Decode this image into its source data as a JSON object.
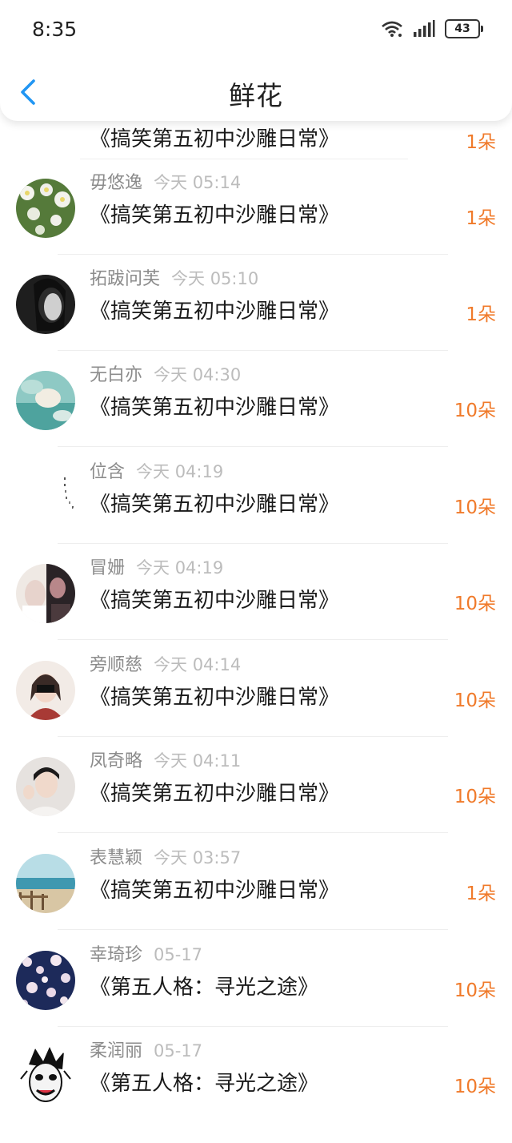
{
  "status_bar": {
    "time": "8:35",
    "battery": "43"
  },
  "header": {
    "title": "鲜花"
  },
  "colors": {
    "accent_blue": "#2196f3",
    "count_orange": "#f07a2a"
  },
  "items": [
    {
      "name": "",
      "time": "",
      "book": "《搞笑第五初中沙雕日常》",
      "count": "1朵"
    },
    {
      "name": "毋悠逸",
      "time": "今天 05:14",
      "book": "《搞笑第五初中沙雕日常》",
      "count": "1朵"
    },
    {
      "name": "拓跋问芙",
      "time": "今天 05:10",
      "book": "《搞笑第五初中沙雕日常》",
      "count": "1朵"
    },
    {
      "name": "无白亦",
      "time": "今天 04:30",
      "book": "《搞笑第五初中沙雕日常》",
      "count": "10朵"
    },
    {
      "name": "位含",
      "time": "今天 04:19",
      "book": "《搞笑第五初中沙雕日常》",
      "count": "10朵"
    },
    {
      "name": "冒姗",
      "time": "今天 04:19",
      "book": "《搞笑第五初中沙雕日常》",
      "count": "10朵"
    },
    {
      "name": "旁顺慈",
      "time": "今天 04:14",
      "book": "《搞笑第五初中沙雕日常》",
      "count": "10朵"
    },
    {
      "name": "凤奇略",
      "time": "今天 04:11",
      "book": "《搞笑第五初中沙雕日常》",
      "count": "10朵"
    },
    {
      "name": "表慧颖",
      "time": "今天 03:57",
      "book": "《搞笑第五初中沙雕日常》",
      "count": "1朵"
    },
    {
      "name": "幸琦珍",
      "time": "05-17",
      "book": "《第五人格：寻光之途》",
      "count": "10朵"
    },
    {
      "name": "柔润丽",
      "time": "05-17",
      "book": "《第五人格：寻光之途》",
      "count": "10朵"
    }
  ]
}
